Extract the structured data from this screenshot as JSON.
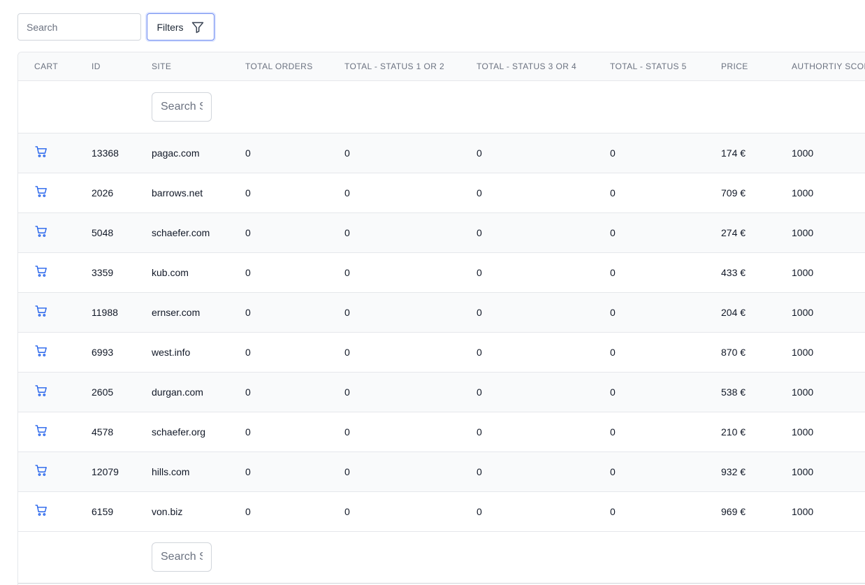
{
  "toolbar": {
    "search_placeholder": "Search",
    "filters_label": "Filters",
    "filters_icon": "filter-icon"
  },
  "table": {
    "columns": [
      "Cart",
      "ID",
      "Site",
      "Total Orders",
      "Total - Status 1 or 2",
      "Total - Status 3 or 4",
      "Total - Status 5",
      "Price",
      "Authortiy Score"
    ],
    "site_search_placeholder": "Search Site",
    "cart_icon": "cart-icon",
    "accent_color": "#2563eb",
    "rows": [
      {
        "id": "13368",
        "site": "pagac.com",
        "total_orders": "0",
        "status_1_2": "0",
        "status_3_4": "0",
        "status_5": "0",
        "price": "174 €",
        "authority": "1000"
      },
      {
        "id": "2026",
        "site": "barrows.net",
        "total_orders": "0",
        "status_1_2": "0",
        "status_3_4": "0",
        "status_5": "0",
        "price": "709 €",
        "authority": "1000"
      },
      {
        "id": "5048",
        "site": "schaefer.com",
        "total_orders": "0",
        "status_1_2": "0",
        "status_3_4": "0",
        "status_5": "0",
        "price": "274 €",
        "authority": "1000"
      },
      {
        "id": "3359",
        "site": "kub.com",
        "total_orders": "0",
        "status_1_2": "0",
        "status_3_4": "0",
        "status_5": "0",
        "price": "433 €",
        "authority": "1000"
      },
      {
        "id": "11988",
        "site": "ernser.com",
        "total_orders": "0",
        "status_1_2": "0",
        "status_3_4": "0",
        "status_5": "0",
        "price": "204 €",
        "authority": "1000"
      },
      {
        "id": "6993",
        "site": "west.info",
        "total_orders": "0",
        "status_1_2": "0",
        "status_3_4": "0",
        "status_5": "0",
        "price": "870 €",
        "authority": "1000"
      },
      {
        "id": "2605",
        "site": "durgan.com",
        "total_orders": "0",
        "status_1_2": "0",
        "status_3_4": "0",
        "status_5": "0",
        "price": "538 €",
        "authority": "1000"
      },
      {
        "id": "4578",
        "site": "schaefer.org",
        "total_orders": "0",
        "status_1_2": "0",
        "status_3_4": "0",
        "status_5": "0",
        "price": "210 €",
        "authority": "1000"
      },
      {
        "id": "12079",
        "site": "hills.com",
        "total_orders": "0",
        "status_1_2": "0",
        "status_3_4": "0",
        "status_5": "0",
        "price": "932 €",
        "authority": "1000"
      },
      {
        "id": "6159",
        "site": "von.biz",
        "total_orders": "0",
        "status_1_2": "0",
        "status_3_4": "0",
        "status_5": "0",
        "price": "969 €",
        "authority": "1000"
      }
    ]
  }
}
